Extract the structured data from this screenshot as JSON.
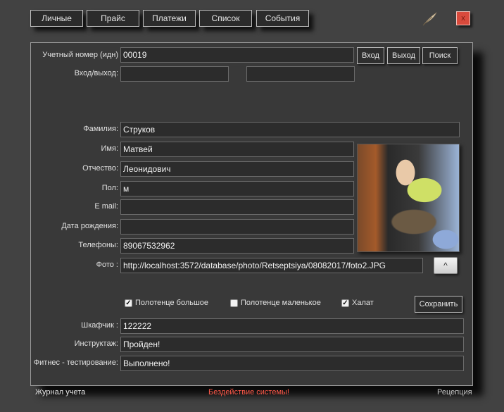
{
  "nav": {
    "tabs": [
      "Личные",
      "Прайс",
      "Платежи",
      "Список",
      "События"
    ],
    "close_label": "x"
  },
  "form": {
    "account_label": "Учетный номер (идн)",
    "account_value": "00019",
    "btn_enter": "Вход",
    "btn_exit": "Выход",
    "btn_search": "Поиск",
    "inout_label": "Вход/выход:",
    "inout_in": "",
    "inout_out": "",
    "surname_label": "Фамилия:",
    "surname_value": "Струков",
    "name_label": "Имя:",
    "name_value": "Матвей",
    "patronymic_label": "Отчество:",
    "patronymic_value": "Леонидович",
    "gender_label": "Пол:",
    "gender_value": "м",
    "email_label": "E mail:",
    "email_value": "",
    "birth_label": "Дата рождения:",
    "birth_value": "",
    "phone_label": "Телефоны:",
    "phone_value": "89067532962",
    "photo_label": "Фото :",
    "photo_value": "http://localhost:3572/database/photo/Retseptsiya/08082017/foto2.JPG",
    "upload_label": "^",
    "towel_big_label": "Полотенце большое",
    "towel_big_checked": true,
    "towel_small_label": "Полотенце маленькое",
    "towel_small_checked": false,
    "robe_label": "Халат",
    "robe_checked": true,
    "save_label": "Сохранить",
    "locker_label": "Шкафчик :",
    "locker_value": "122222",
    "briefing_label": "Инструктаж:",
    "briefing_value": "Пройден!",
    "fitness_label": "Фитнес - тестирование:",
    "fitness_value": "Выполнено!"
  },
  "footer": {
    "left": "Журнал учета",
    "center": "Бездействие системы!",
    "right": "Рецепция"
  },
  "colors": {
    "alert_text": "#ff5a4a",
    "close_button": "#d94a3c"
  }
}
